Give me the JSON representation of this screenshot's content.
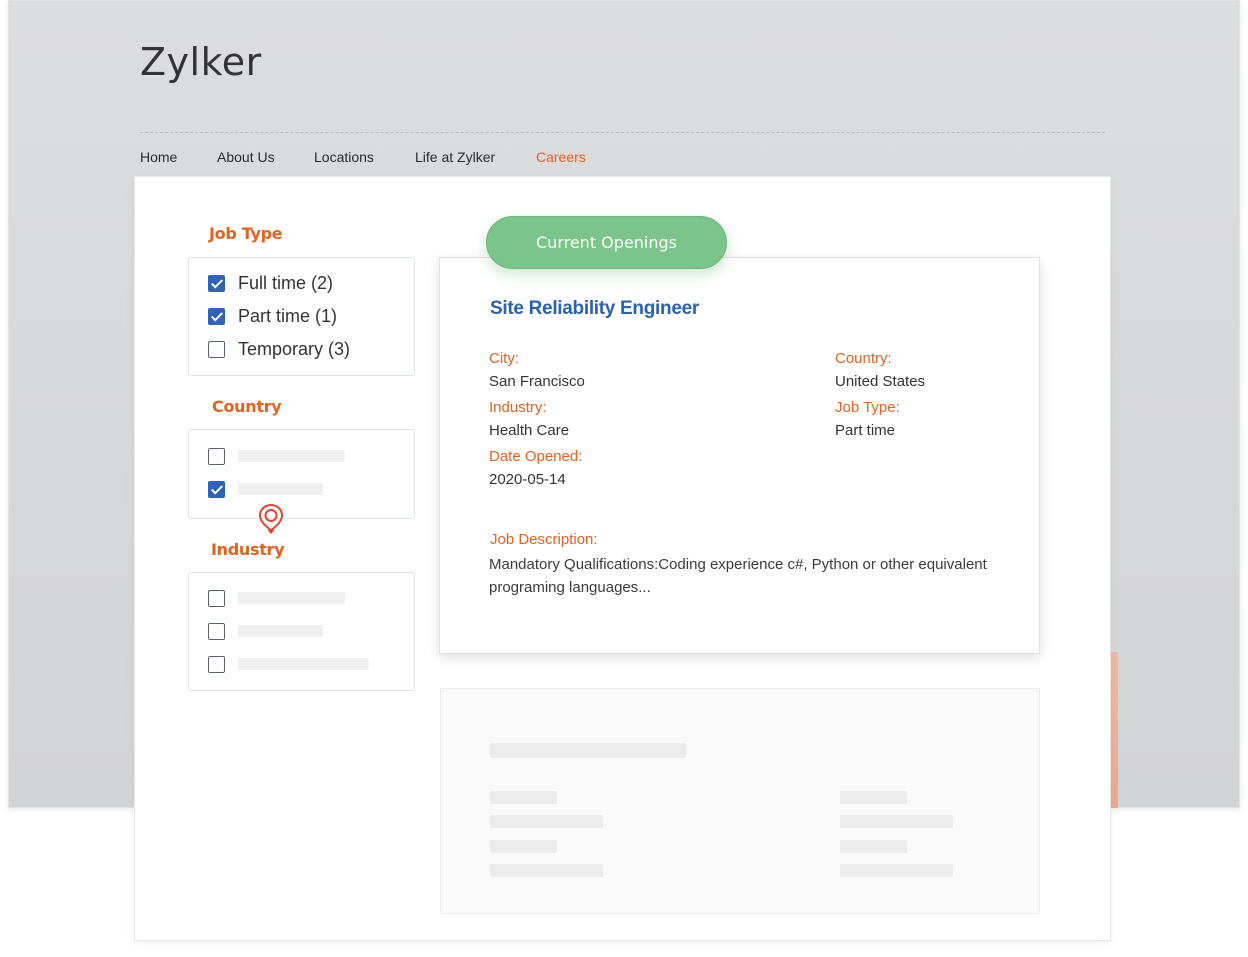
{
  "site": {
    "brand": "Zylker",
    "nav": [
      {
        "label": "Home",
        "active": false
      },
      {
        "label": "About Us",
        "active": false
      },
      {
        "label": "Locations",
        "active": false
      },
      {
        "label": "Life at Zylker",
        "active": false
      },
      {
        "label": "Careers",
        "active": true
      }
    ]
  },
  "filters": {
    "job_type": {
      "title": "Job Type",
      "options": [
        {
          "label": "Full time (2)",
          "checked": true
        },
        {
          "label": "Part time (1)",
          "checked": true
        },
        {
          "label": "Temporary (3)",
          "checked": false
        }
      ]
    },
    "country": {
      "title": "Country",
      "options": [
        {
          "checked": false
        },
        {
          "checked": true
        }
      ]
    },
    "industry": {
      "title": "Industry",
      "options": [
        {
          "checked": false
        },
        {
          "checked": false
        },
        {
          "checked": false
        }
      ]
    }
  },
  "openings_button": "Current Openings",
  "job": {
    "title": "Site Reliability Engineer",
    "city_label": "City:",
    "city": "San Francisco",
    "country_label": "Country:",
    "country": "United States",
    "industry_label": "Industry:",
    "industry": "Health Care",
    "job_type_label": "Job Type:",
    "job_type": "Part time",
    "date_label": "Date Opened:",
    "date": "2020-05-14",
    "description_label": "Job Description:",
    "description": "Mandatory Qualifications:Coding experience c#, Python or other equivalent programing languages..."
  },
  "colors": {
    "accent_orange": "#e4621e",
    "link_blue": "#2862b0",
    "button_green": "#7cc58a",
    "checkbox_blue": "#2f63b5"
  },
  "icons": {
    "pin": "location-pin-icon"
  }
}
